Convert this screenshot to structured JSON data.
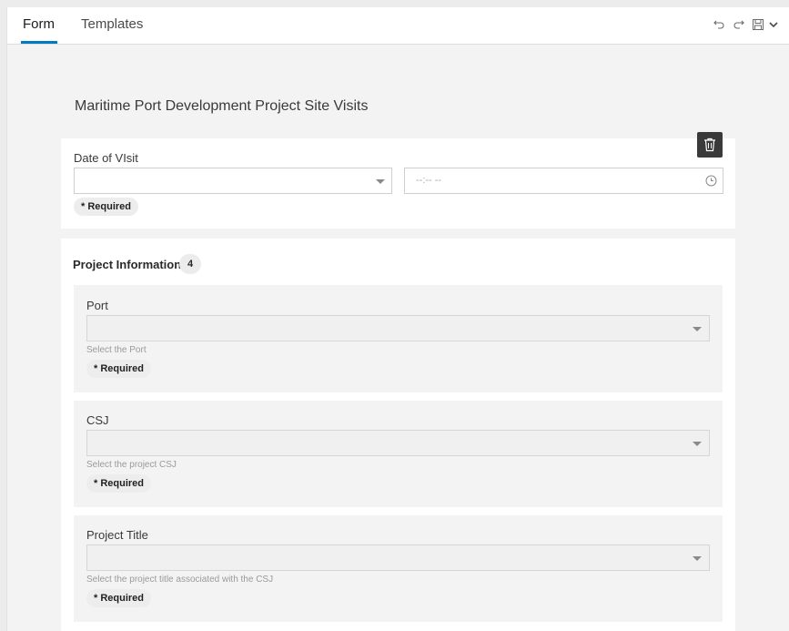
{
  "tabs": [
    {
      "label": "Form",
      "active": true
    },
    {
      "label": "Templates",
      "active": false
    }
  ],
  "toolbar": {
    "undo_icon": "undo-icon",
    "redo_icon": "redo-icon",
    "save_icon": "save-icon",
    "menu_icon": "chevron-down-icon"
  },
  "form": {
    "title": "Maritime Port Development Project Site Visits"
  },
  "date_visit": {
    "label": "Date of VIsit",
    "date_value": "",
    "time_placeholder": "--:-- --",
    "required": "* Required"
  },
  "group": {
    "title": "Project Information",
    "count": "4",
    "fields": [
      {
        "label": "Port",
        "value": "",
        "hint": "Select the Port",
        "required": "* Required"
      },
      {
        "label": "CSJ",
        "value": "",
        "hint": "Select the project CSJ",
        "required": "* Required"
      },
      {
        "label": "Project Title",
        "value": "",
        "hint": "Select the project title associated with the CSJ",
        "required": "* Required"
      }
    ]
  },
  "colors": {
    "accent": "#007ac2",
    "background": "#f3f3f3",
    "card": "#ffffff"
  }
}
